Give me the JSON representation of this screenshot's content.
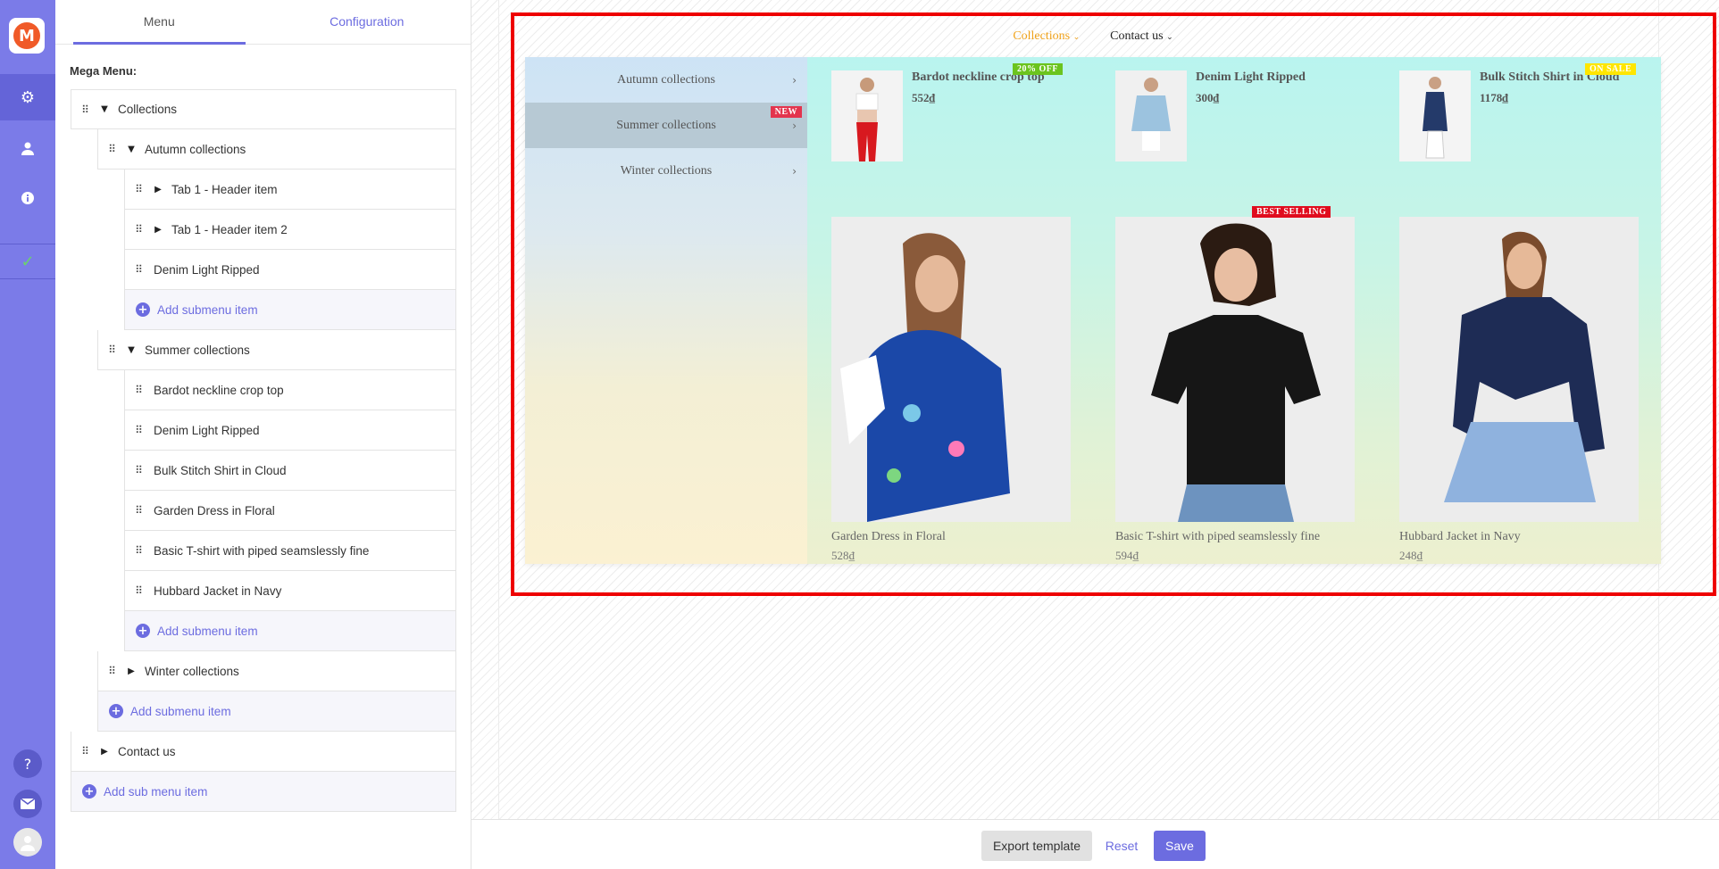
{
  "app": {
    "logo_letter": "M",
    "brand_color": "#f05a28",
    "accent": "#6c6ce0"
  },
  "rail": {
    "icons": [
      "gear-icon",
      "user-icon",
      "info-icon",
      "check-icon",
      "question-icon",
      "mail-icon",
      "avatar"
    ]
  },
  "tabs": {
    "menu": "Menu",
    "configuration": "Configuration"
  },
  "panel": {
    "title": "Mega Menu:"
  },
  "tree": {
    "collections": "Collections",
    "autumn": "Autumn collections",
    "tab1_header": "Tab 1 - Header item",
    "tab1_header2": "Tab 1 - Header item 2",
    "denim_autumn": "Denim Light Ripped",
    "add_submenu": "Add submenu item",
    "summer": "Summer collections",
    "bardot": "Bardot neckline crop top",
    "denim_summer": "Denim Light Ripped",
    "bulk": "Bulk Stitch Shirt in Cloud",
    "garden": "Garden Dress in Floral",
    "basic": "Basic T-shirt with piped seamslessly fine",
    "hubbard": "Hubbard Jacket in Navy",
    "winter": "Winter collections",
    "contact": "Contact us",
    "add_sub_menu": "Add sub menu item"
  },
  "preview": {
    "nav": {
      "collections": "Collections",
      "contact": "Contact us"
    },
    "menu_items": [
      {
        "label": "Autumn collections"
      },
      {
        "label": "Summer collections",
        "badge": "NEW"
      },
      {
        "label": "Winter collections"
      }
    ],
    "top_products": [
      {
        "title": "Bardot neckline crop top",
        "price": "552₫",
        "badge": "20% OFF"
      },
      {
        "title": "Denim Light Ripped",
        "price": "300₫"
      },
      {
        "title": "Bulk Stitch Shirt in Cloud",
        "price": "1178₫",
        "badge": "ON SALE"
      }
    ],
    "big_products": [
      {
        "title": "Garden Dress in Floral",
        "price": "528₫"
      },
      {
        "title": "Basic T-shirt with piped seamslessly fine",
        "price": "594₫",
        "badge": "BEST SELLING"
      },
      {
        "title": "Hubbard Jacket in Navy",
        "price": "248₫"
      }
    ]
  },
  "footer": {
    "export": "Export template",
    "reset": "Reset",
    "save": "Save"
  }
}
